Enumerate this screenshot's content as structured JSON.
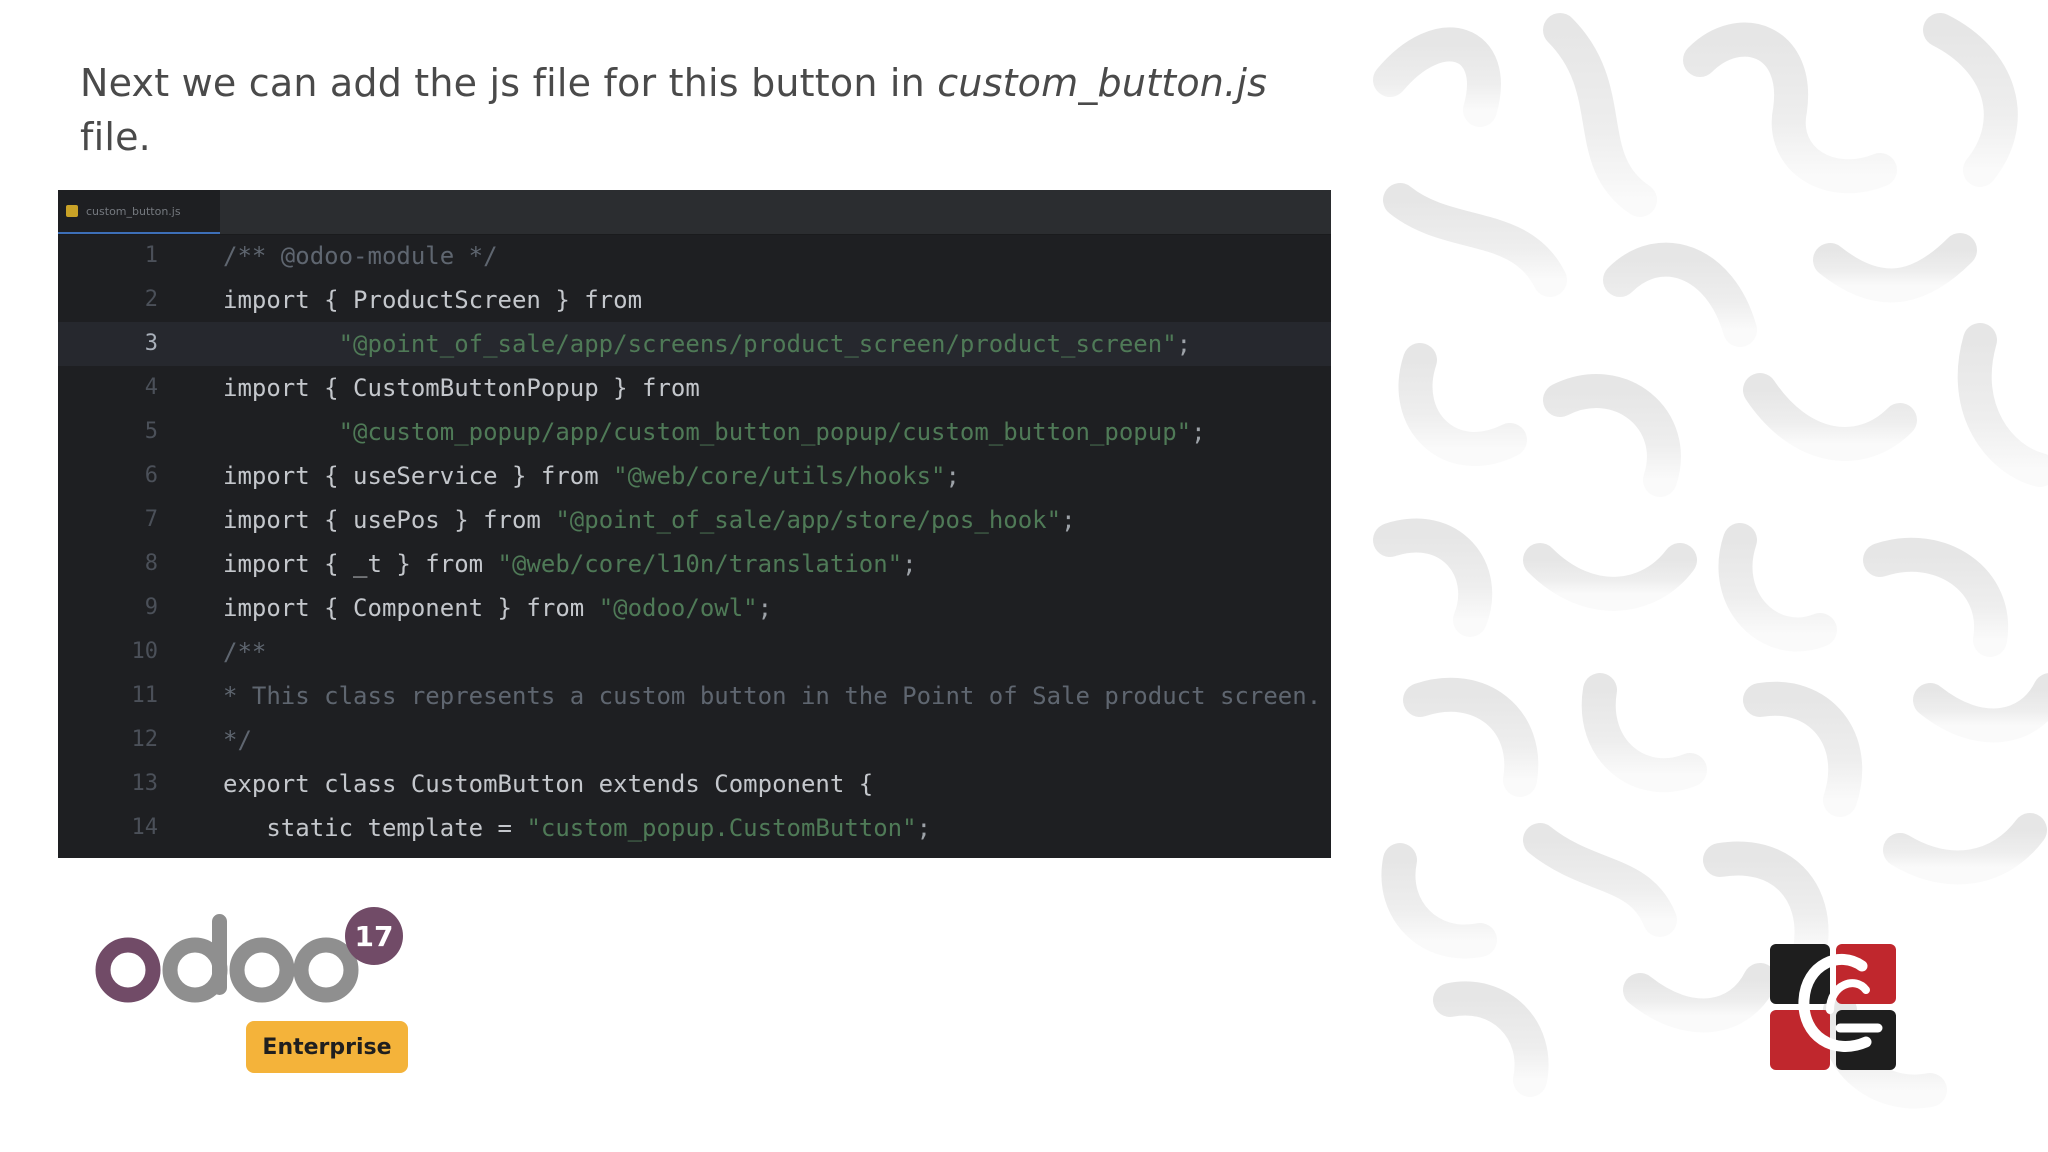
{
  "heading": {
    "prefix": "Next we can add the js file for this button in ",
    "filename": "custom_button.js",
    "suffix": " file."
  },
  "editor": {
    "tab_label": "custom_button.js",
    "active_line": 3,
    "lines": [
      {
        "no": "1",
        "tokens": [
          {
            "t": "comment",
            "v": "/** @odoo-module */"
          }
        ]
      },
      {
        "no": "2",
        "tokens": [
          {
            "t": "keyword",
            "v": "import { ProductScreen } from"
          }
        ]
      },
      {
        "no": "3",
        "tokens": [
          {
            "t": "string",
            "v": "        \"@point_of_sale/app/screens/product_screen/product_screen\""
          },
          {
            "t": "punct",
            "v": ";"
          }
        ]
      },
      {
        "no": "4",
        "tokens": [
          {
            "t": "keyword",
            "v": "import { CustomButtonPopup } from"
          }
        ]
      },
      {
        "no": "5",
        "tokens": [
          {
            "t": "string",
            "v": "        \"@custom_popup/app/custom_button_popup/custom_button_popup\""
          },
          {
            "t": "punct",
            "v": ";"
          }
        ]
      },
      {
        "no": "6",
        "tokens": [
          {
            "t": "keyword",
            "v": "import { useService } from "
          },
          {
            "t": "string",
            "v": "\"@web/core/utils/hooks\""
          },
          {
            "t": "punct",
            "v": ";"
          }
        ]
      },
      {
        "no": "7",
        "tokens": [
          {
            "t": "keyword",
            "v": "import { usePos } from "
          },
          {
            "t": "string",
            "v": "\"@point_of_sale/app/store/pos_hook\""
          },
          {
            "t": "punct",
            "v": ";"
          }
        ]
      },
      {
        "no": "8",
        "tokens": [
          {
            "t": "keyword",
            "v": "import { _t } from "
          },
          {
            "t": "string",
            "v": "\"@web/core/l10n/translation\""
          },
          {
            "t": "punct",
            "v": ";"
          }
        ]
      },
      {
        "no": "9",
        "tokens": [
          {
            "t": "keyword",
            "v": "import { Component } from "
          },
          {
            "t": "string",
            "v": "\"@odoo/owl\""
          },
          {
            "t": "punct",
            "v": ";"
          }
        ]
      },
      {
        "no": "10",
        "tokens": [
          {
            "t": "comment",
            "v": "/**"
          }
        ]
      },
      {
        "no": "11",
        "tokens": [
          {
            "t": "comment",
            "v": "* This class represents a custom button in the Point of Sale product screen."
          }
        ]
      },
      {
        "no": "12",
        "tokens": [
          {
            "t": "comment",
            "v": "*/"
          }
        ]
      },
      {
        "no": "13",
        "tokens": [
          {
            "t": "keyword",
            "v": "export class CustomButton extends Component {"
          }
        ]
      },
      {
        "no": "14",
        "tokens": [
          {
            "t": "keyword",
            "v": "   static template = "
          },
          {
            "t": "string",
            "v": "\"custom_popup.CustomButton\""
          },
          {
            "t": "punct",
            "v": ";"
          }
        ]
      }
    ]
  },
  "odoo_logo": {
    "wordmark": "odoo",
    "version": "17",
    "edition": "Enterprise"
  },
  "colors": {
    "odoo_purple": "#714b67",
    "odoo_gray": "#8f8f8f",
    "enterprise_badge": "#f4b33a",
    "brand_red": "#c0272d",
    "brand_dark": "#1e1e1e",
    "pattern": "#ececec"
  }
}
